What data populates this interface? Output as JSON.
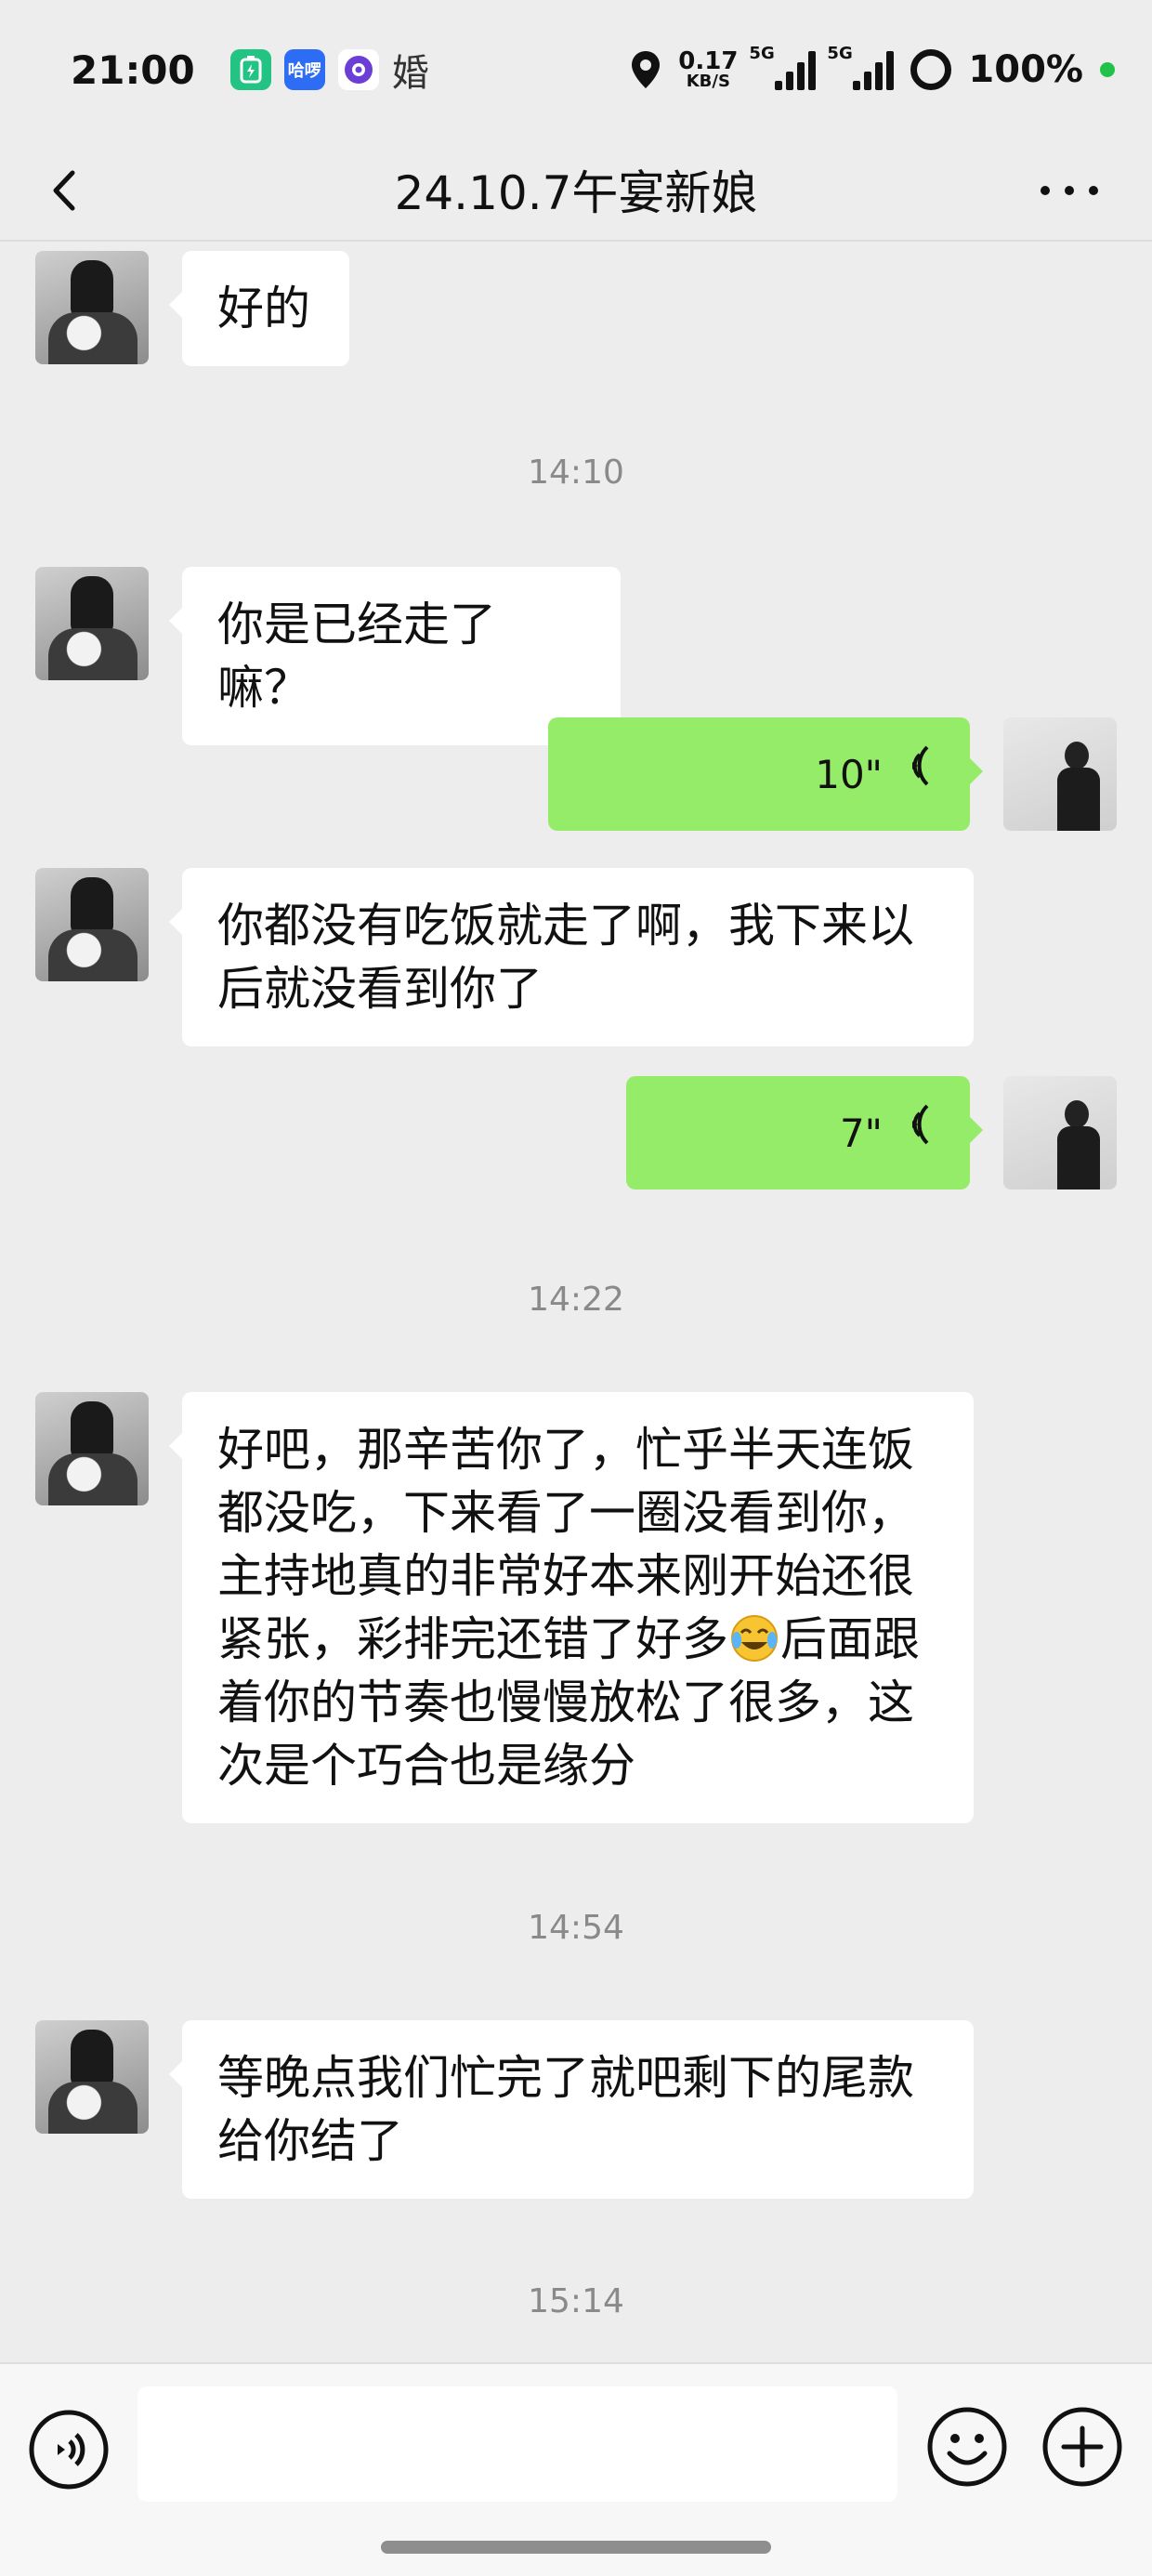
{
  "status_bar": {
    "time": "21:00",
    "app_icon_1": "battery-saver-app-icon",
    "app_icon_2_label": "哈啰",
    "app_icon_3": "browser-app-icon",
    "app_icon_4_char": "婚",
    "net_speed_value": "0.17",
    "net_speed_unit": "KB/S",
    "signal_1_tag": "5G",
    "signal_2_tag": "5G",
    "battery": "100%",
    "battery_dot_color": "#21c24a"
  },
  "nav": {
    "title": "24.10.7午宴新娘"
  },
  "messages": [
    {
      "side": "left",
      "text": "好的"
    },
    {
      "time": "14:10"
    },
    {
      "side": "left",
      "text": "你是已经走了嘛？"
    },
    {
      "side": "right",
      "voice_duration": "10\""
    },
    {
      "side": "left",
      "lines": [
        "你都没有吃饭就走了啊，我下来以",
        "后就没看到你了"
      ]
    },
    {
      "side": "right",
      "voice_duration": "7\""
    },
    {
      "time": "14:22"
    },
    {
      "side": "left",
      "lines": [
        "好吧，那辛苦你了，忙乎半天连饭",
        "都没吃，下来看了一圈没看到你，",
        "主持地真的非常好本来刚开始还很",
        "紧张，彩排完还错了好多",
        "后面跟",
        "着你的节奏也慢慢放松了很多，这",
        "次是个巧合也是缘分"
      ],
      "emoji": "laughing-crying-emoji"
    },
    {
      "time": "14:54"
    },
    {
      "side": "left",
      "lines": [
        "等晚点我们忙完了就吧剩下的尾款",
        "给你结了"
      ]
    },
    {
      "time": "15:14"
    }
  ],
  "input_bar": {
    "voice_button": "voice-input-icon",
    "emoji_button": "emoji-icon",
    "plus_button": "plus-icon",
    "accent_color": "#95ec69"
  }
}
